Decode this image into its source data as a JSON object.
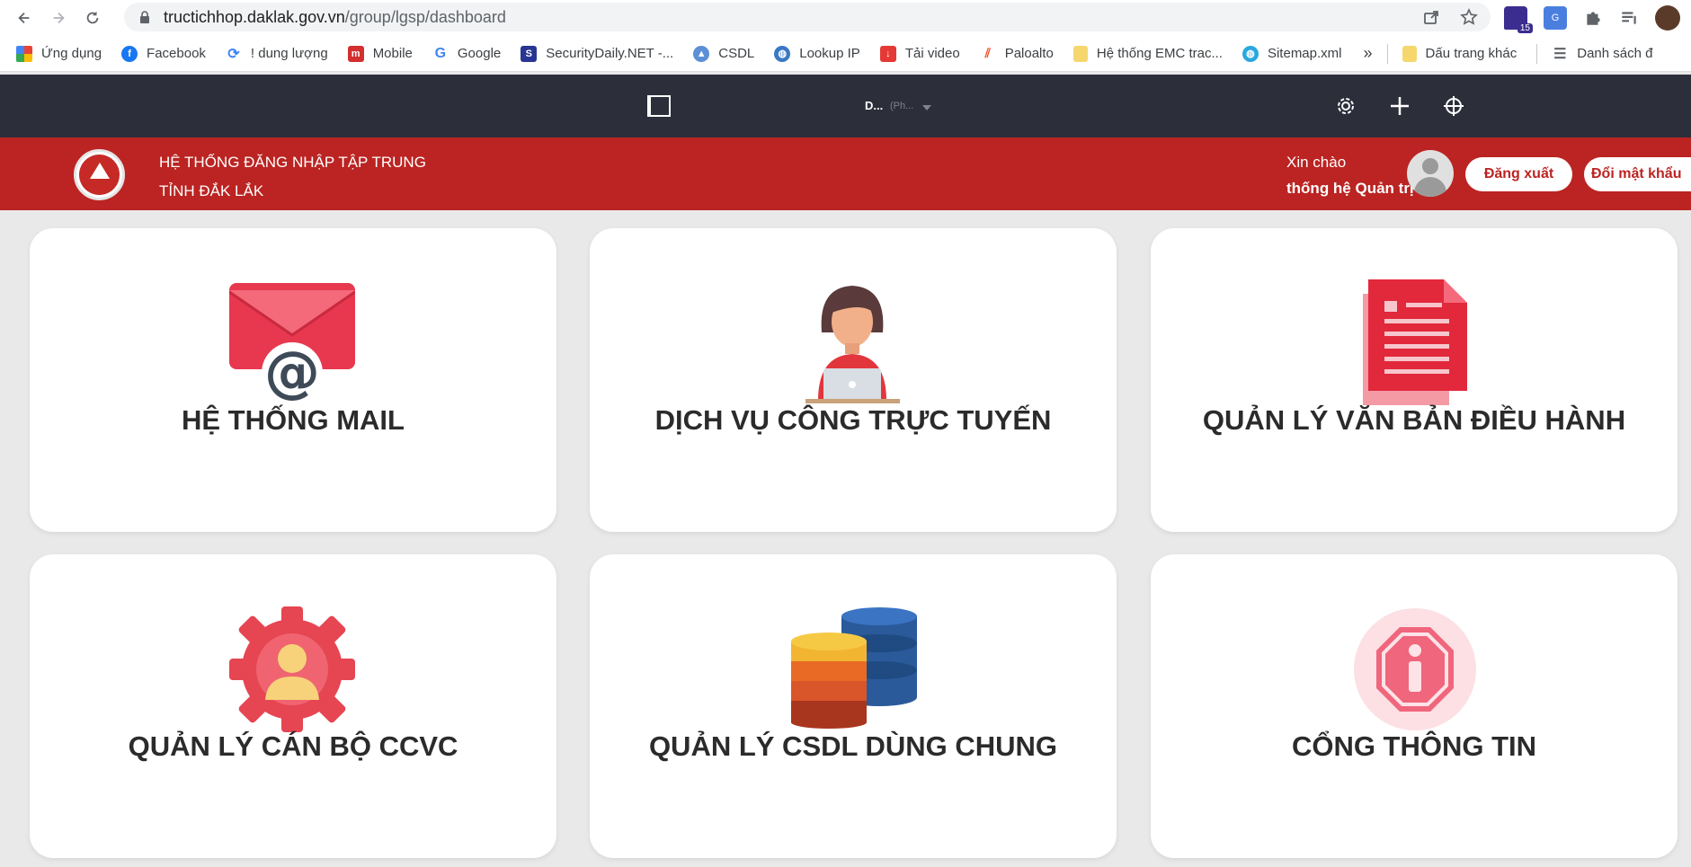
{
  "browser": {
    "url_host": "tructichhop.daklak.gov.vn",
    "url_path": "/group/lgsp/dashboard",
    "extension_badge": "15",
    "bookmarks": [
      {
        "label": "Ứng dụng",
        "icon": "apps-grid-icon"
      },
      {
        "label": "Facebook",
        "icon": "facebook-icon"
      },
      {
        "label": "! dung lượng",
        "icon": "sync-icon"
      },
      {
        "label": "Mobile",
        "icon": "mobile-icon"
      },
      {
        "label": "Google",
        "icon": "google-icon"
      },
      {
        "label": "SecurityDaily.NET -...",
        "icon": "securitydaily-icon"
      },
      {
        "label": "CSDL",
        "icon": "csdl-icon"
      },
      {
        "label": "Lookup IP",
        "icon": "globe-icon"
      },
      {
        "label": "Tải video",
        "icon": "download-icon"
      },
      {
        "label": "Paloalto",
        "icon": "paloalto-icon"
      },
      {
        "label": "Hệ thống EMC trac...",
        "icon": "folder-icon"
      },
      {
        "label": "Sitemap.xml",
        "icon": "globe-icon"
      }
    ],
    "more": "»",
    "other_bookmarks": "Dấu trang khác",
    "reading_list": "Danh sách đ"
  },
  "toolbar": {
    "doc_name": "D...",
    "doc_sub": "(Ph..."
  },
  "header": {
    "title_line1": "HỆ THỐNG ĐĂNG NHẬP TẬP TRUNG",
    "title_line2": "TỈNH ĐẮK LẮK",
    "greeting": "Xin chào",
    "user_name": "thống hệ Quản trị",
    "logout": "Đăng xuất",
    "change_password": "Đổi mật khẩu"
  },
  "cards": [
    {
      "title": "HỆ THỐNG MAIL",
      "icon": "mail-icon"
    },
    {
      "title": "DỊCH VỤ CÔNG TRỰC TUYẾN",
      "icon": "person-laptop-icon"
    },
    {
      "title": "QUẢN LÝ VĂN BẢN ĐIỀU HÀNH",
      "icon": "document-icon"
    },
    {
      "title": "QUẢN LÝ CÁN BỘ CCVC",
      "icon": "user-gear-icon"
    },
    {
      "title": "QUẢN LÝ CSDL DÙNG CHUNG",
      "icon": "database-icon"
    },
    {
      "title": "CỔNG THÔNG TIN",
      "icon": "info-icon"
    }
  ],
  "colors": {
    "header_red": "#bb2422",
    "toolbar_dark": "#2c2e3a",
    "page_bg": "#e9e9e9"
  }
}
